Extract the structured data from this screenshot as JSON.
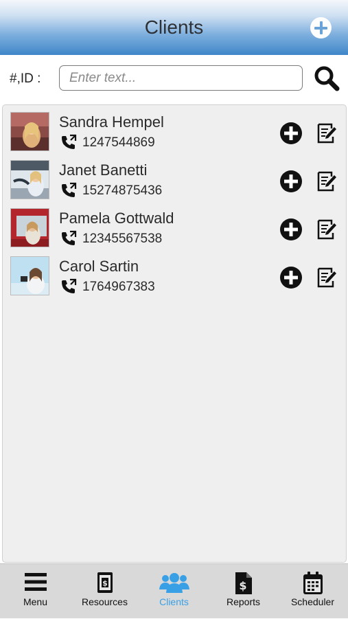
{
  "header": {
    "title": "Clients"
  },
  "search": {
    "label": "#,ID :",
    "placeholder": "Enter text...",
    "value": ""
  },
  "clients": [
    {
      "name": "Sandra Hempel",
      "phone": "1247544869"
    },
    {
      "name": "Janet Banetti",
      "phone": "15274875436"
    },
    {
      "name": "Pamela Gottwald",
      "phone": "12345567538"
    },
    {
      "name": "Carol Sartin",
      "phone": "1764967383"
    }
  ],
  "tabs": [
    {
      "label": "Menu",
      "icon": "menu-icon"
    },
    {
      "label": "Resources",
      "icon": "resources-icon"
    },
    {
      "label": "Clients",
      "icon": "clients-icon",
      "active": true
    },
    {
      "label": "Reports",
      "icon": "reports-icon"
    },
    {
      "label": "Scheduler",
      "icon": "calendar-icon"
    }
  ],
  "colors": {
    "header_top": "#f4f7fb",
    "header_bottom": "#3f86c9",
    "active_tab": "#3aa0e6",
    "list_background": "#efefef",
    "tabbar_background": "#d9d9d9"
  }
}
